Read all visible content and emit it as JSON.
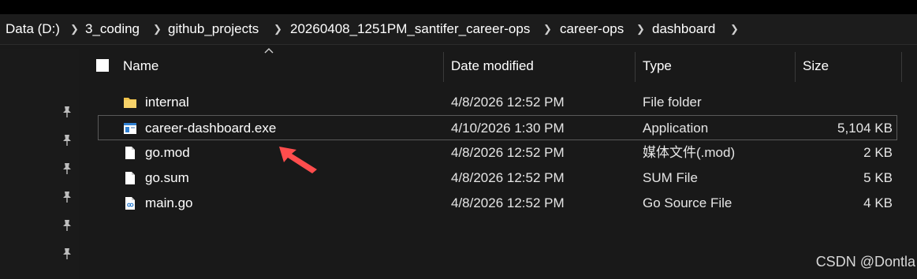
{
  "breadcrumb": {
    "items": [
      "Data (D:)",
      "3_coding",
      "github_projects",
      "20260408_1251PM_santifer_career-ops",
      "career-ops",
      "dashboard"
    ]
  },
  "columns": {
    "name": "Name",
    "date_modified": "Date modified",
    "type": "Type",
    "size": "Size"
  },
  "files": [
    {
      "name": "internal",
      "date": "4/8/2026 12:52 PM",
      "type": "File folder",
      "size": "",
      "icon": "folder-icon"
    },
    {
      "name": "career-dashboard.exe",
      "date": "4/10/2026 1:30 PM",
      "type": "Application",
      "size": "5,104 KB",
      "icon": "application-icon"
    },
    {
      "name": "go.mod",
      "date": "4/8/2026 12:52 PM",
      "type": "媒体文件(.mod)",
      "size": "2 KB",
      "icon": "file-icon"
    },
    {
      "name": "go.sum",
      "date": "4/8/2026 12:52 PM",
      "type": "SUM File",
      "size": "5 KB",
      "icon": "file-icon"
    },
    {
      "name": "main.go",
      "date": "4/8/2026 12:52 PM",
      "type": "Go Source File",
      "size": "4 KB",
      "icon": "go-file-icon"
    }
  ],
  "watermark": "CSDN @Dontla",
  "colors": {
    "background": "#191919",
    "annotation_arrow": "#ff4d4d",
    "folder": "#f0c24a",
    "app_icon_blue": "#2f7fd1"
  }
}
